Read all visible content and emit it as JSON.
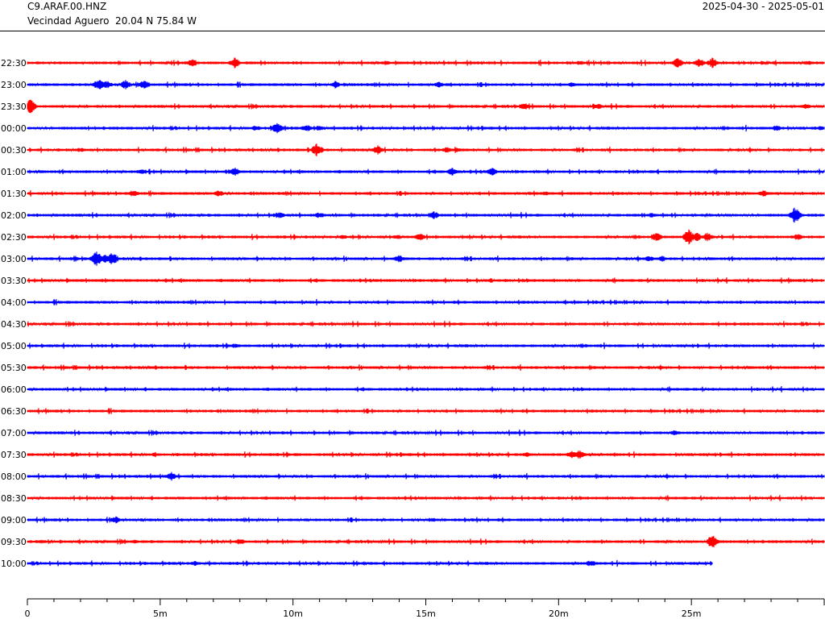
{
  "header": {
    "station": "C9.ARAF.00.HNZ",
    "location": "Vecindad Aguero  20.04 N 75.84 W",
    "date_range": "2025-04-30 - 2025-05-01"
  },
  "colors": {
    "trace_a": "#ff0000",
    "trace_b": "#0000ff",
    "axis": "#000000"
  },
  "chart_data": {
    "type": "line",
    "title": "",
    "xlabel": "",
    "ylabel": "",
    "x_ticks": [
      "0",
      "5m",
      "10m",
      "15m",
      "20m",
      "25m"
    ],
    "xlim_minutes": [
      0,
      30
    ],
    "grid": false,
    "series": [
      {
        "label": "22:30",
        "color": "#ff0000",
        "end_minute": 30,
        "events": [
          [
            6.2,
            5
          ],
          [
            7.8,
            7
          ],
          [
            24.5,
            7
          ],
          [
            25.3,
            6
          ],
          [
            25.8,
            7
          ],
          [
            13.5,
            3
          ],
          [
            20.8,
            3
          ],
          [
            29.4,
            3
          ]
        ]
      },
      {
        "label": "23:00",
        "color": "#0000ff",
        "end_minute": 30,
        "events": [
          [
            2.7,
            8
          ],
          [
            3.0,
            5
          ],
          [
            3.7,
            6
          ],
          [
            4.4,
            7
          ],
          [
            11.6,
            5
          ],
          [
            15.5,
            4
          ],
          [
            20.5,
            3
          ]
        ]
      },
      {
        "label": "23:30",
        "color": "#ff0000",
        "end_minute": 30,
        "events": [
          [
            0.1,
            10
          ],
          [
            18.7,
            5
          ],
          [
            21.5,
            4
          ],
          [
            29.3,
            4
          ]
        ]
      },
      {
        "label": "00:00",
        "color": "#0000ff",
        "end_minute": 30,
        "events": [
          [
            9.4,
            7
          ],
          [
            8.6,
            4
          ],
          [
            10.5,
            5
          ],
          [
            11.0,
            4
          ],
          [
            28.2,
            4
          ],
          [
            29.9,
            3
          ]
        ]
      },
      {
        "label": "00:30",
        "color": "#ff0000",
        "end_minute": 30,
        "events": [
          [
            2.0,
            3
          ],
          [
            10.9,
            9
          ],
          [
            13.2,
            6
          ],
          [
            15.8,
            4
          ],
          [
            16.2,
            3
          ]
        ]
      },
      {
        "label": "01:00",
        "color": "#0000ff",
        "end_minute": 30,
        "events": [
          [
            4.3,
            4
          ],
          [
            7.8,
            6
          ],
          [
            16.0,
            5
          ],
          [
            17.5,
            5
          ],
          [
            23.5,
            2
          ]
        ]
      },
      {
        "label": "01:30",
        "color": "#ff0000",
        "end_minute": 30,
        "events": [
          [
            4.0,
            5
          ],
          [
            7.2,
            4
          ],
          [
            19.5,
            3
          ],
          [
            27.7,
            4
          ]
        ]
      },
      {
        "label": "02:00",
        "color": "#0000ff",
        "end_minute": 30,
        "events": [
          [
            9.5,
            4
          ],
          [
            11.0,
            4
          ],
          [
            15.3,
            5
          ],
          [
            23.5,
            3
          ],
          [
            28.9,
            11
          ]
        ]
      },
      {
        "label": "02:30",
        "color": "#ff0000",
        "end_minute": 30,
        "events": [
          [
            11.9,
            3
          ],
          [
            13.9,
            3
          ],
          [
            14.8,
            5
          ],
          [
            23.7,
            6
          ],
          [
            24.9,
            10
          ],
          [
            25.2,
            6
          ],
          [
            25.6,
            6
          ],
          [
            29.0,
            4
          ]
        ]
      },
      {
        "label": "03:00",
        "color": "#0000ff",
        "end_minute": 30,
        "events": [
          [
            1.8,
            3
          ],
          [
            2.6,
            10
          ],
          [
            2.9,
            6
          ],
          [
            3.2,
            9
          ],
          [
            14.0,
            5
          ],
          [
            23.4,
            4
          ],
          [
            23.9,
            4
          ]
        ]
      },
      {
        "label": "03:30",
        "color": "#ff0000",
        "end_minute": 30,
        "events": [
          [
            2.8,
            2
          ],
          [
            17.2,
            1
          ]
        ]
      },
      {
        "label": "04:00",
        "color": "#0000ff",
        "end_minute": 30,
        "events": [
          [
            4.5,
            2
          ],
          [
            10.7,
            2
          ],
          [
            20.2,
            2
          ],
          [
            28.7,
            1
          ]
        ]
      },
      {
        "label": "04:30",
        "color": "#ff0000",
        "end_minute": 30,
        "events": [
          [
            25.8,
            1
          ]
        ]
      },
      {
        "label": "05:00",
        "color": "#0000ff",
        "end_minute": 30,
        "events": [
          [
            7.8,
            3
          ]
        ]
      },
      {
        "label": "05:30",
        "color": "#ff0000",
        "end_minute": 30,
        "events": []
      },
      {
        "label": "06:00",
        "color": "#0000ff",
        "end_minute": 30,
        "events": []
      },
      {
        "label": "06:30",
        "color": "#ff0000",
        "end_minute": 30,
        "events": []
      },
      {
        "label": "07:00",
        "color": "#0000ff",
        "end_minute": 30,
        "events": [
          [
            17.2,
            1
          ],
          [
            24.4,
            4
          ],
          [
            25.2,
            2
          ]
        ]
      },
      {
        "label": "07:30",
        "color": "#ff0000",
        "end_minute": 30,
        "events": [
          [
            4.8,
            3
          ],
          [
            10.1,
            2
          ],
          [
            18.8,
            3
          ],
          [
            20.5,
            5
          ],
          [
            20.8,
            6
          ],
          [
            22.2,
            2
          ],
          [
            23.6,
            2
          ]
        ]
      },
      {
        "label": "08:00",
        "color": "#0000ff",
        "end_minute": 30,
        "events": [
          [
            4.7,
            2
          ],
          [
            5.4,
            6
          ]
        ]
      },
      {
        "label": "08:30",
        "color": "#ff0000",
        "end_minute": 30,
        "events": [
          [
            6.7,
            1
          ]
        ]
      },
      {
        "label": "09:00",
        "color": "#0000ff",
        "end_minute": 30,
        "events": [
          [
            3.3,
            5
          ],
          [
            10.5,
            2
          ],
          [
            15.3,
            3
          ]
        ]
      },
      {
        "label": "09:30",
        "color": "#ff0000",
        "end_minute": 30,
        "events": [
          [
            0.5,
            3
          ],
          [
            4.0,
            3
          ],
          [
            8.0,
            4
          ],
          [
            23.7,
            2
          ],
          [
            25.8,
            10
          ]
        ]
      },
      {
        "label": "10:00",
        "color": "#0000ff",
        "end_minute": 25.8,
        "events": [
          [
            6.3,
            3
          ],
          [
            13.0,
            2
          ],
          [
            21.2,
            4
          ]
        ]
      }
    ]
  }
}
